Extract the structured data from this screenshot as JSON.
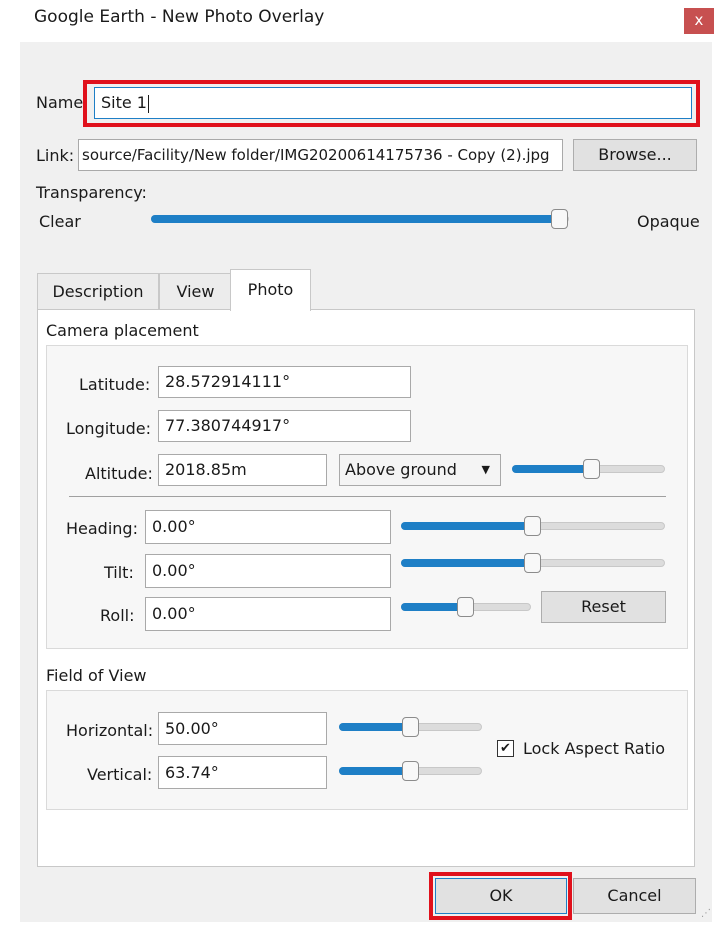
{
  "window": {
    "title": "Google Earth - New Photo Overlay",
    "close_label": "x"
  },
  "name": {
    "label": "Name:",
    "value": "Site 1"
  },
  "link": {
    "label": "Link:",
    "value": "source/Facility/New folder/IMG20200614175736 - Copy (2).jpg",
    "browse_label": "Browse..."
  },
  "transparency": {
    "label": "Transparency:",
    "min_label": "Clear",
    "max_label": "Opaque",
    "level": 0.98
  },
  "tabs": [
    {
      "label": "Description",
      "active": false
    },
    {
      "label": "View",
      "active": false
    },
    {
      "label": "Photo",
      "active": true
    }
  ],
  "camera": {
    "section_label": "Camera placement",
    "latitude": {
      "label": "Latitude:",
      "value": "28.572914111°"
    },
    "longitude": {
      "label": "Longitude:",
      "value": "77.380744917°"
    },
    "altitude": {
      "label": "Altitude:",
      "value": "2018.85m",
      "mode": "Above ground",
      "slider_level": 0.52
    },
    "heading": {
      "label": "Heading:",
      "value": "0.00°",
      "slider_level": 0.5
    },
    "tilt": {
      "label": "Tilt:",
      "value": "0.00°",
      "slider_level": 0.5
    },
    "roll": {
      "label": "Roll:",
      "value": "0.00°",
      "slider_level": 0.5
    },
    "reset_label": "Reset"
  },
  "fov": {
    "section_label": "Field of View",
    "horizontal": {
      "label": "Horizontal:",
      "value": "50.00°",
      "slider_level": 0.5
    },
    "vertical": {
      "label": "Vertical:",
      "value": "63.74°",
      "slider_level": 0.5
    },
    "lock_aspect": {
      "label": "Lock Aspect Ratio",
      "checked": true,
      "check_glyph": "✔"
    }
  },
  "buttons": {
    "ok_label": "OK",
    "cancel_label": "Cancel"
  },
  "colors": {
    "accent": "#1e7fc6",
    "highlight": "#e0111c",
    "close": "#c75050"
  }
}
